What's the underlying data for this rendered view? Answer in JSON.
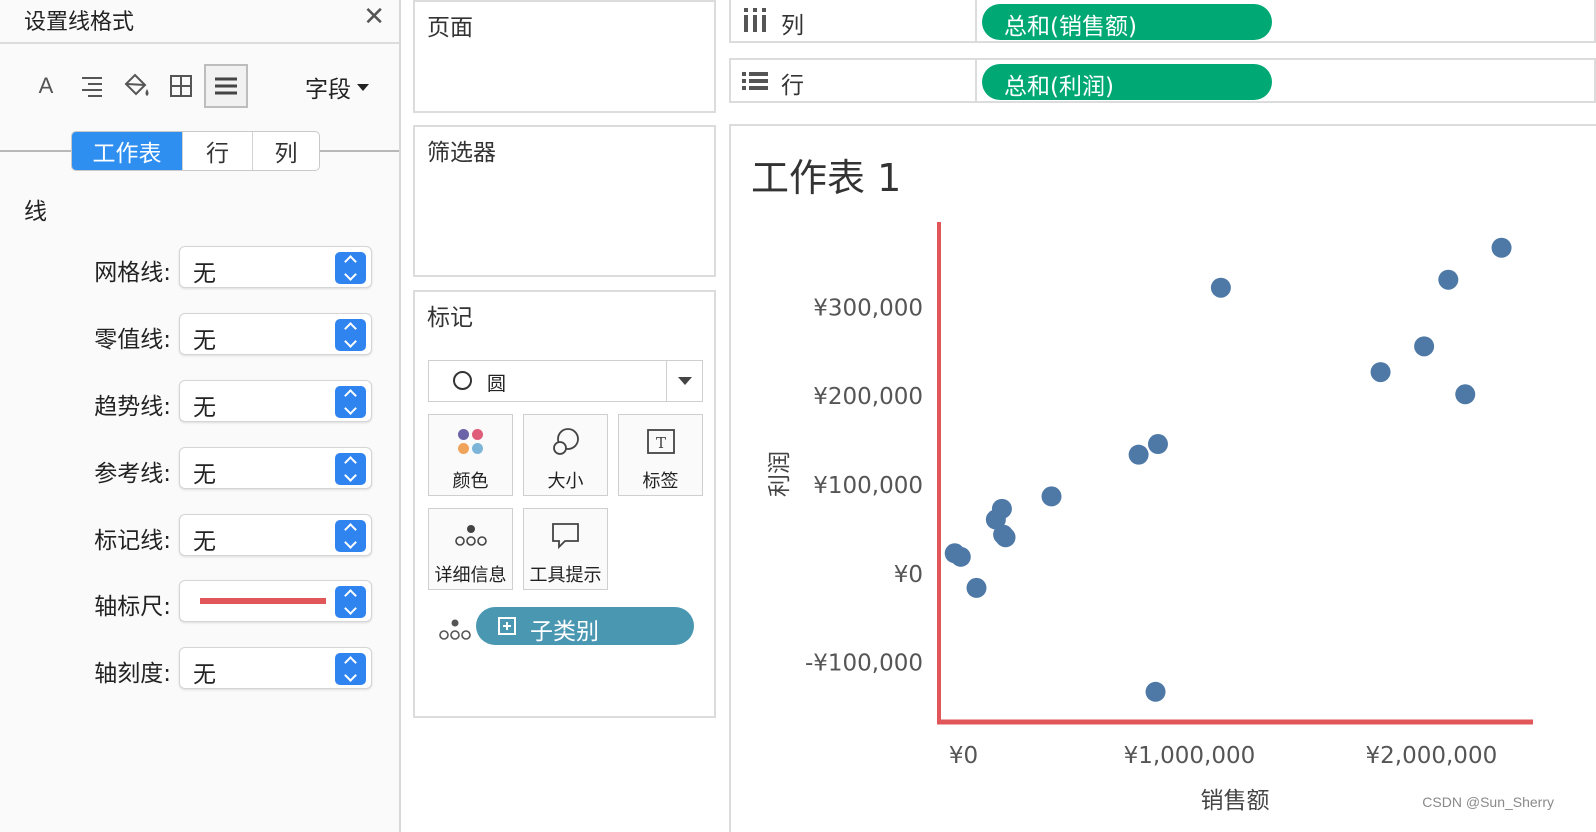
{
  "format_pane": {
    "title": "设置线格式",
    "close_glyph": "✕",
    "toolbar": {
      "font_icon_glyph": "A",
      "align_icon_glyph": "≡",
      "fields_label": "字段"
    },
    "tabs": [
      {
        "label": "工作表",
        "active": true
      },
      {
        "label": "行",
        "active": false
      },
      {
        "label": "列",
        "active": false
      }
    ],
    "section_title": "线",
    "rows": [
      {
        "label": "网格线:",
        "value": "无"
      },
      {
        "label": "零值线:",
        "value": "无"
      },
      {
        "label": "趋势线:",
        "value": "无"
      },
      {
        "label": "参考线:",
        "value": "无"
      },
      {
        "label": "标记线:",
        "value": "无"
      },
      {
        "label": "轴标尺:",
        "value": "",
        "line_color": "#e15759"
      },
      {
        "label": "轴刻度:",
        "value": "无"
      }
    ]
  },
  "cards": {
    "pages_title": "页面",
    "filters_title": "筛选器",
    "marks": {
      "title": "标记",
      "mark_type": "圆",
      "buttons": [
        {
          "label": "颜色",
          "icon": "color-icon"
        },
        {
          "label": "大小",
          "icon": "size-icon"
        },
        {
          "label": "标签",
          "icon": "label-icon"
        },
        {
          "label": "详细信息",
          "icon": "detail-icon"
        },
        {
          "label": "工具提示",
          "icon": "tooltip-icon"
        }
      ],
      "detail_pill": "子类别",
      "detail_pill_color": "#4a97b2"
    }
  },
  "shelves": {
    "columns": {
      "label": "列",
      "pill": "总和(销售额)"
    },
    "rows": {
      "label": "行",
      "pill": "总和(利润)"
    },
    "pill_color": "#00a974"
  },
  "worksheet_title": "工作表 1",
  "chart_data": {
    "type": "scatter",
    "title": "工作表 1",
    "xlabel": "销售额",
    "ylabel": "利润",
    "xlim": [
      -35000,
      2420000
    ],
    "ylim": [
      -168000,
      395000
    ],
    "x_ticks": [
      {
        "value": 0,
        "label": "¥0"
      },
      {
        "value": 1000000,
        "label": "¥1,000,000"
      },
      {
        "value": 2000000,
        "label": "¥2,000,000"
      }
    ],
    "y_ticks": [
      {
        "value": 300000,
        "label": "¥300,000"
      },
      {
        "value": 200000,
        "label": "¥200,000"
      },
      {
        "value": 100000,
        "label": "¥100,000"
      },
      {
        "value": 0,
        "label": "¥0"
      },
      {
        "value": -100000,
        "label": "-¥100,000"
      }
    ],
    "grid": false,
    "axis_ruler_color": "#e15759",
    "point_color": "#4e79a7",
    "points": [
      {
        "x": 30000,
        "y": 22000
      },
      {
        "x": 55000,
        "y": 18000
      },
      {
        "x": 120000,
        "y": -17000
      },
      {
        "x": 200000,
        "y": 60000
      },
      {
        "x": 225000,
        "y": 72000
      },
      {
        "x": 230000,
        "y": 43000
      },
      {
        "x": 240000,
        "y": 40000
      },
      {
        "x": 430000,
        "y": 86000
      },
      {
        "x": 790000,
        "y": 133000
      },
      {
        "x": 870000,
        "y": 145000
      },
      {
        "x": 860000,
        "y": -134000
      },
      {
        "x": 1130000,
        "y": 321000
      },
      {
        "x": 1790000,
        "y": 226000
      },
      {
        "x": 1970000,
        "y": 255000
      },
      {
        "x": 2070000,
        "y": 330000
      },
      {
        "x": 2140000,
        "y": 201000
      },
      {
        "x": 2290000,
        "y": 366000
      }
    ]
  },
  "watermark": "CSDN @Sun_Sherry"
}
